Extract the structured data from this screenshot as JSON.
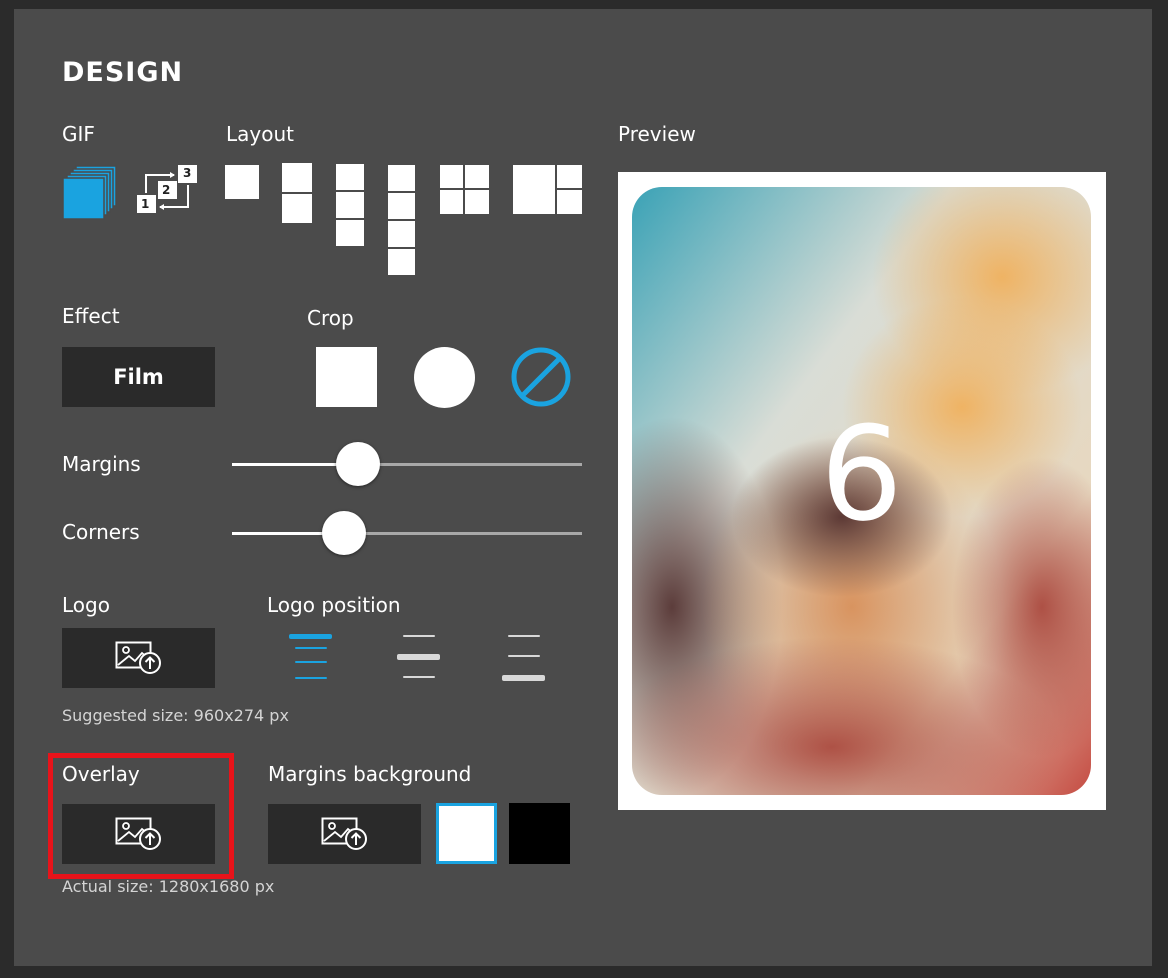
{
  "title": "DESIGN",
  "gif": {
    "label": "GIF",
    "options": [
      {
        "name": "gif-stack-icon",
        "selected": true
      },
      {
        "name": "gif-sequence-icon",
        "selected": false,
        "numbers": [
          "1",
          "2",
          "3"
        ]
      }
    ]
  },
  "layout": {
    "label": "Layout"
  },
  "preview": {
    "label": "Preview",
    "countdown": "6"
  },
  "effect": {
    "label": "Effect",
    "value": "Film"
  },
  "crop": {
    "label": "Crop",
    "selected": "none"
  },
  "margins": {
    "label": "Margins",
    "value": 0.36
  },
  "corners": {
    "label": "Corners",
    "value": 0.32
  },
  "logo": {
    "label": "Logo",
    "hint": "Suggested size: 960x274 px"
  },
  "logo_position": {
    "label": "Logo position",
    "selected": "top"
  },
  "overlay": {
    "label": "Overlay",
    "hint": "Actual size: 1280x1680 px"
  },
  "margins_background": {
    "label": "Margins background",
    "swatches": [
      "#ffffff",
      "#000000"
    ],
    "selected": "#ffffff"
  },
  "colors": {
    "accent": "#1aa3e0",
    "highlight": "#e8131a",
    "panel": "#4b4b4b",
    "button": "#2a2a2a"
  }
}
